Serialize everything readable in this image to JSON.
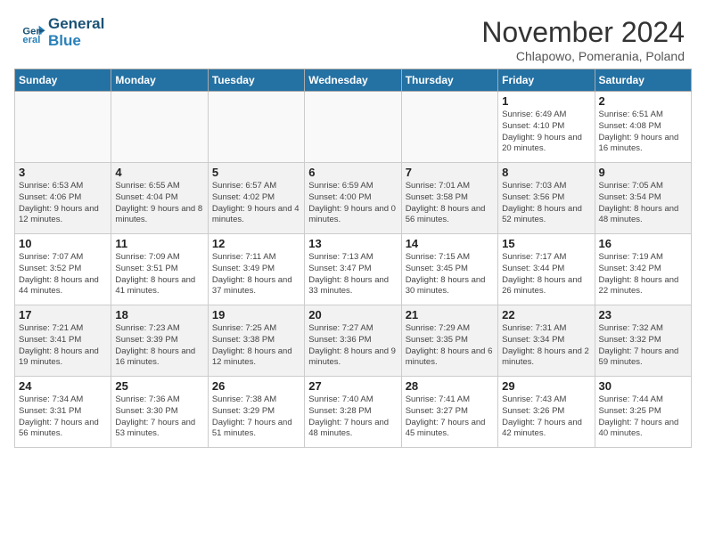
{
  "header": {
    "logo_line1": "General",
    "logo_line2": "Blue",
    "month": "November 2024",
    "location": "Chlapowo, Pomerania, Poland"
  },
  "days_of_week": [
    "Sunday",
    "Monday",
    "Tuesday",
    "Wednesday",
    "Thursday",
    "Friday",
    "Saturday"
  ],
  "weeks": [
    [
      {
        "day": "",
        "empty": true
      },
      {
        "day": "",
        "empty": true
      },
      {
        "day": "",
        "empty": true
      },
      {
        "day": "",
        "empty": true
      },
      {
        "day": "",
        "empty": true
      },
      {
        "day": "1",
        "sunrise": "Sunrise: 6:49 AM",
        "sunset": "Sunset: 4:10 PM",
        "daylight": "Daylight: 9 hours and 20 minutes."
      },
      {
        "day": "2",
        "sunrise": "Sunrise: 6:51 AM",
        "sunset": "Sunset: 4:08 PM",
        "daylight": "Daylight: 9 hours and 16 minutes."
      }
    ],
    [
      {
        "day": "3",
        "sunrise": "Sunrise: 6:53 AM",
        "sunset": "Sunset: 4:06 PM",
        "daylight": "Daylight: 9 hours and 12 minutes."
      },
      {
        "day": "4",
        "sunrise": "Sunrise: 6:55 AM",
        "sunset": "Sunset: 4:04 PM",
        "daylight": "Daylight: 9 hours and 8 minutes."
      },
      {
        "day": "5",
        "sunrise": "Sunrise: 6:57 AM",
        "sunset": "Sunset: 4:02 PM",
        "daylight": "Daylight: 9 hours and 4 minutes."
      },
      {
        "day": "6",
        "sunrise": "Sunrise: 6:59 AM",
        "sunset": "Sunset: 4:00 PM",
        "daylight": "Daylight: 9 hours and 0 minutes."
      },
      {
        "day": "7",
        "sunrise": "Sunrise: 7:01 AM",
        "sunset": "Sunset: 3:58 PM",
        "daylight": "Daylight: 8 hours and 56 minutes."
      },
      {
        "day": "8",
        "sunrise": "Sunrise: 7:03 AM",
        "sunset": "Sunset: 3:56 PM",
        "daylight": "Daylight: 8 hours and 52 minutes."
      },
      {
        "day": "9",
        "sunrise": "Sunrise: 7:05 AM",
        "sunset": "Sunset: 3:54 PM",
        "daylight": "Daylight: 8 hours and 48 minutes."
      }
    ],
    [
      {
        "day": "10",
        "sunrise": "Sunrise: 7:07 AM",
        "sunset": "Sunset: 3:52 PM",
        "daylight": "Daylight: 8 hours and 44 minutes."
      },
      {
        "day": "11",
        "sunrise": "Sunrise: 7:09 AM",
        "sunset": "Sunset: 3:51 PM",
        "daylight": "Daylight: 8 hours and 41 minutes."
      },
      {
        "day": "12",
        "sunrise": "Sunrise: 7:11 AM",
        "sunset": "Sunset: 3:49 PM",
        "daylight": "Daylight: 8 hours and 37 minutes."
      },
      {
        "day": "13",
        "sunrise": "Sunrise: 7:13 AM",
        "sunset": "Sunset: 3:47 PM",
        "daylight": "Daylight: 8 hours and 33 minutes."
      },
      {
        "day": "14",
        "sunrise": "Sunrise: 7:15 AM",
        "sunset": "Sunset: 3:45 PM",
        "daylight": "Daylight: 8 hours and 30 minutes."
      },
      {
        "day": "15",
        "sunrise": "Sunrise: 7:17 AM",
        "sunset": "Sunset: 3:44 PM",
        "daylight": "Daylight: 8 hours and 26 minutes."
      },
      {
        "day": "16",
        "sunrise": "Sunrise: 7:19 AM",
        "sunset": "Sunset: 3:42 PM",
        "daylight": "Daylight: 8 hours and 22 minutes."
      }
    ],
    [
      {
        "day": "17",
        "sunrise": "Sunrise: 7:21 AM",
        "sunset": "Sunset: 3:41 PM",
        "daylight": "Daylight: 8 hours and 19 minutes."
      },
      {
        "day": "18",
        "sunrise": "Sunrise: 7:23 AM",
        "sunset": "Sunset: 3:39 PM",
        "daylight": "Daylight: 8 hours and 16 minutes."
      },
      {
        "day": "19",
        "sunrise": "Sunrise: 7:25 AM",
        "sunset": "Sunset: 3:38 PM",
        "daylight": "Daylight: 8 hours and 12 minutes."
      },
      {
        "day": "20",
        "sunrise": "Sunrise: 7:27 AM",
        "sunset": "Sunset: 3:36 PM",
        "daylight": "Daylight: 8 hours and 9 minutes."
      },
      {
        "day": "21",
        "sunrise": "Sunrise: 7:29 AM",
        "sunset": "Sunset: 3:35 PM",
        "daylight": "Daylight: 8 hours and 6 minutes."
      },
      {
        "day": "22",
        "sunrise": "Sunrise: 7:31 AM",
        "sunset": "Sunset: 3:34 PM",
        "daylight": "Daylight: 8 hours and 2 minutes."
      },
      {
        "day": "23",
        "sunrise": "Sunrise: 7:32 AM",
        "sunset": "Sunset: 3:32 PM",
        "daylight": "Daylight: 7 hours and 59 minutes."
      }
    ],
    [
      {
        "day": "24",
        "sunrise": "Sunrise: 7:34 AM",
        "sunset": "Sunset: 3:31 PM",
        "daylight": "Daylight: 7 hours and 56 minutes."
      },
      {
        "day": "25",
        "sunrise": "Sunrise: 7:36 AM",
        "sunset": "Sunset: 3:30 PM",
        "daylight": "Daylight: 7 hours and 53 minutes."
      },
      {
        "day": "26",
        "sunrise": "Sunrise: 7:38 AM",
        "sunset": "Sunset: 3:29 PM",
        "daylight": "Daylight: 7 hours and 51 minutes."
      },
      {
        "day": "27",
        "sunrise": "Sunrise: 7:40 AM",
        "sunset": "Sunset: 3:28 PM",
        "daylight": "Daylight: 7 hours and 48 minutes."
      },
      {
        "day": "28",
        "sunrise": "Sunrise: 7:41 AM",
        "sunset": "Sunset: 3:27 PM",
        "daylight": "Daylight: 7 hours and 45 minutes."
      },
      {
        "day": "29",
        "sunrise": "Sunrise: 7:43 AM",
        "sunset": "Sunset: 3:26 PM",
        "daylight": "Daylight: 7 hours and 42 minutes."
      },
      {
        "day": "30",
        "sunrise": "Sunrise: 7:44 AM",
        "sunset": "Sunset: 3:25 PM",
        "daylight": "Daylight: 7 hours and 40 minutes."
      }
    ]
  ]
}
